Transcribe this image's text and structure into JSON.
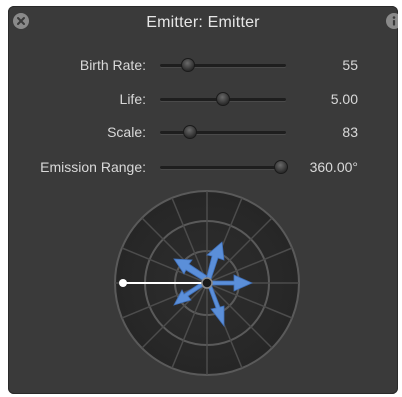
{
  "window": {
    "title": "Emitter: Emitter"
  },
  "params": [
    {
      "label": "Birth Rate:",
      "value": "55",
      "fraction": 0.22
    },
    {
      "label": "Life:",
      "value": "5.00",
      "fraction": 0.5
    },
    {
      "label": "Scale:",
      "value": "83",
      "fraction": 0.24
    },
    {
      "label": "Emission Range:",
      "value": "360.00°",
      "fraction": 0.96
    }
  ],
  "colors": {
    "panel": "#3a3a3a",
    "text": "#d9d9d9",
    "arrow": "#5b8fd9",
    "dial_ring": "#5a5a5a",
    "angle_line": "#ffffff"
  },
  "icons": {
    "close": "close-icon",
    "info": "info-icon"
  }
}
